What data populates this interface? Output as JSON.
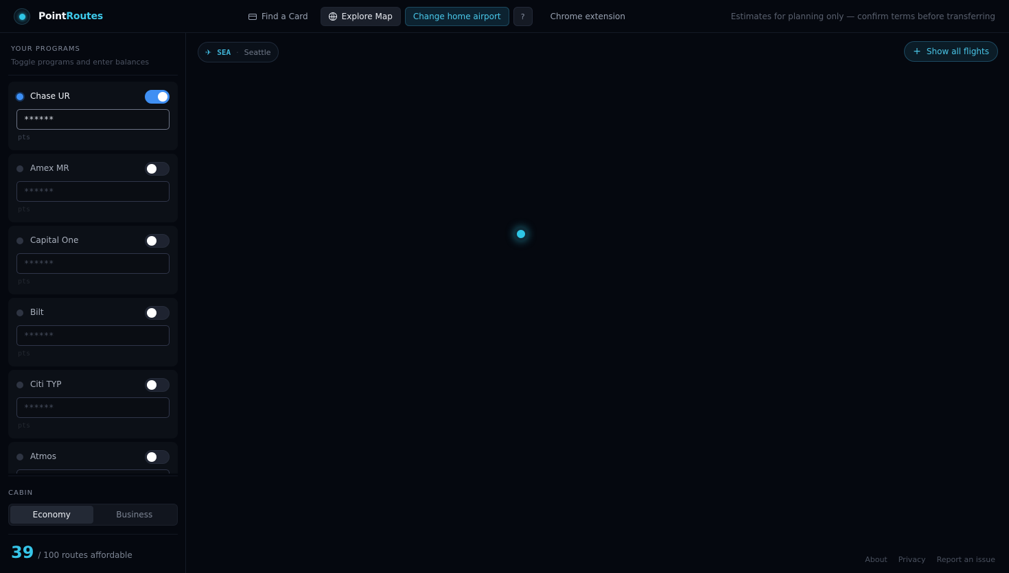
{
  "brand": {
    "name_main": "Point",
    "name_accent": "Routes"
  },
  "nav": {
    "find_card": "Find a Card",
    "explore_map": "Explore Map",
    "change_airport": "Change home airport",
    "help": "?",
    "chrome_extension": "Chrome extension"
  },
  "disclaimer": "Estimates for planning only — confirm terms before transferring",
  "sidebar": {
    "title": "YOUR PROGRAMS",
    "subtitle": "Toggle programs and enter balances",
    "programs": [
      {
        "name": "Chase UR",
        "enabled": true,
        "placeholder": "******",
        "unit": "pts"
      },
      {
        "name": "Amex MR",
        "enabled": false,
        "placeholder": "******",
        "unit": "pts"
      },
      {
        "name": "Capital One",
        "enabled": false,
        "placeholder": "******",
        "unit": "pts"
      },
      {
        "name": "Bilt",
        "enabled": false,
        "placeholder": "******",
        "unit": "pts"
      },
      {
        "name": "Citi TYP",
        "enabled": false,
        "placeholder": "******",
        "unit": "pts"
      },
      {
        "name": "Atmos",
        "enabled": false,
        "placeholder": "******",
        "unit": "pts"
      }
    ],
    "cabin": {
      "label": "CABIN",
      "options": [
        "Economy",
        "Business"
      ],
      "selected": "Economy"
    },
    "affordable": {
      "count": "39",
      "text": "/ 100 routes affordable"
    }
  },
  "map": {
    "home": {
      "code": "SEA",
      "separator": "·",
      "city": "Seattle"
    },
    "show_all": "Show all flights"
  },
  "footer": {
    "about": "About",
    "privacy": "Privacy",
    "report": "Report an issue"
  },
  "colors": {
    "accent": "#2ec6e6",
    "toggle_on": "#3f8ff3",
    "background": "#05080f"
  }
}
